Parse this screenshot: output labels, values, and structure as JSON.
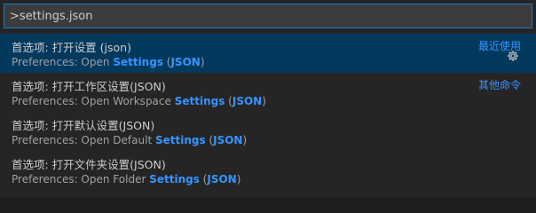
{
  "input": {
    "value": ">settings.json"
  },
  "items": [
    {
      "label": "首选项: 打开设置 (json)",
      "detail_prefix": "Preferences: Open ",
      "detail_hl1": "Settings",
      "detail_mid": " (",
      "detail_hl2": "JSON",
      "detail_suffix": ")",
      "group_label": "最近使用",
      "selected": true,
      "icon": "gear-icon"
    },
    {
      "label": "首选项: 打开工作区设置(JSON)",
      "detail_prefix": "Preferences: Open Workspace ",
      "detail_hl1": "Settings",
      "detail_mid": " (",
      "detail_hl2": "JSON",
      "detail_suffix": ")",
      "group_label": "其他命令"
    },
    {
      "label": "首选项: 打开默认设置(JSON)",
      "detail_prefix": "Preferences: Open Default ",
      "detail_hl1": "Settings",
      "detail_mid": " (",
      "detail_hl2": "JSON",
      "detail_suffix": ")"
    },
    {
      "label": "首选项: 打开文件夹设置(JSON)",
      "detail_prefix": "Preferences: Open Folder ",
      "detail_hl1": "Settings",
      "detail_mid": " (",
      "detail_hl2": "JSON",
      "detail_suffix": ")"
    }
  ],
  "colors": {
    "accent": "#3794ff",
    "selected_bg": "#04395e",
    "focus_border": "#1f78c4"
  }
}
